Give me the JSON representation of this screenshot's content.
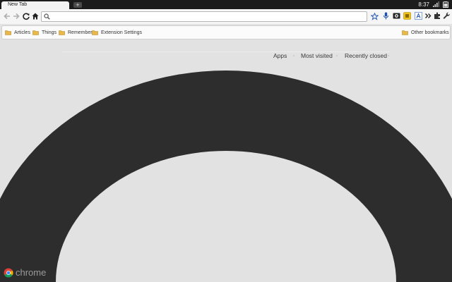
{
  "tab": {
    "title": "New Tab",
    "new_tab_symbol": "+"
  },
  "status": {
    "time": "8:37"
  },
  "omnibox": {
    "value": "",
    "placeholder": ""
  },
  "bookmarks": {
    "items": [
      {
        "label": "Articles"
      },
      {
        "label": "Things"
      },
      {
        "label": "Remember"
      },
      {
        "label": "Extension Settings"
      }
    ],
    "other_label": "Other bookmarks"
  },
  "ntp": {
    "nav": [
      {
        "label": "Apps"
      },
      {
        "label": "Most visited"
      },
      {
        "label": "Recently closed"
      }
    ]
  },
  "brand": {
    "name": "chrome"
  },
  "colors": {
    "titlebar": "#1c1c1c",
    "page_background": "#e2e2e2",
    "theme_arch": "#2d2d2d",
    "folder": "#e8b84a",
    "accent_blue": "#2a5db8"
  },
  "icons": [
    "back-arrow-icon",
    "forward-arrow-icon",
    "reload-icon",
    "home-icon",
    "search-icon",
    "star-icon",
    "microphone-icon",
    "camera-extension-icon",
    "yellow-extension-icon",
    "translate-extension-icon",
    "overflow-chevron-icon",
    "puzzle-extension-icon",
    "wrench-icon",
    "folder-icon",
    "signal-icon",
    "battery-icon",
    "chrome-logo-icon"
  ]
}
